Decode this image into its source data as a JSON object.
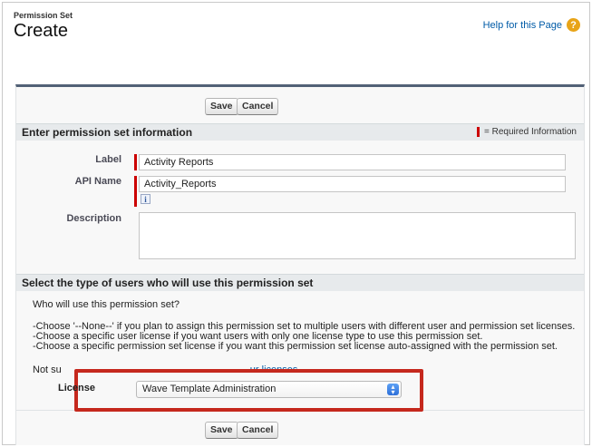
{
  "header": {
    "object_label": "Permission Set",
    "page_title": "Create",
    "help_link": "Help for this Page",
    "help_icon": "question-circle-icon"
  },
  "toolbar": {
    "save_label": "Save",
    "cancel_label": "Cancel"
  },
  "section_info": {
    "title": "Enter permission set information",
    "required_legend": "= Required Information"
  },
  "fields": {
    "label": {
      "label": "Label",
      "value": "Activity Reports"
    },
    "api_name": {
      "label": "API Name",
      "value": "Activity_Reports",
      "info_icon": "i"
    },
    "description": {
      "label": "Description",
      "value": ""
    }
  },
  "section_users": {
    "title": "Select the type of users who will use this permission set",
    "question": "Who will use this permission set?",
    "lines": [
      "-Choose '--None--' if you plan to assign this permission set to multiple users with different user and permission set licenses.",
      "-Choose a specific user license if you want users with only one license type to use this permission set.",
      "-Choose a specific permission set license if you want this permission set license auto-assigned with the permission set."
    ],
    "not_sure_prefix": "Not su",
    "not_sure_link": "ur licenses.",
    "license_label": "License",
    "license_value": "Wave Template Administration"
  },
  "colors": {
    "required": "#c00000",
    "highlight_box": "#c5281d",
    "panel_top_border": "#526176",
    "link": "#015ba7"
  }
}
